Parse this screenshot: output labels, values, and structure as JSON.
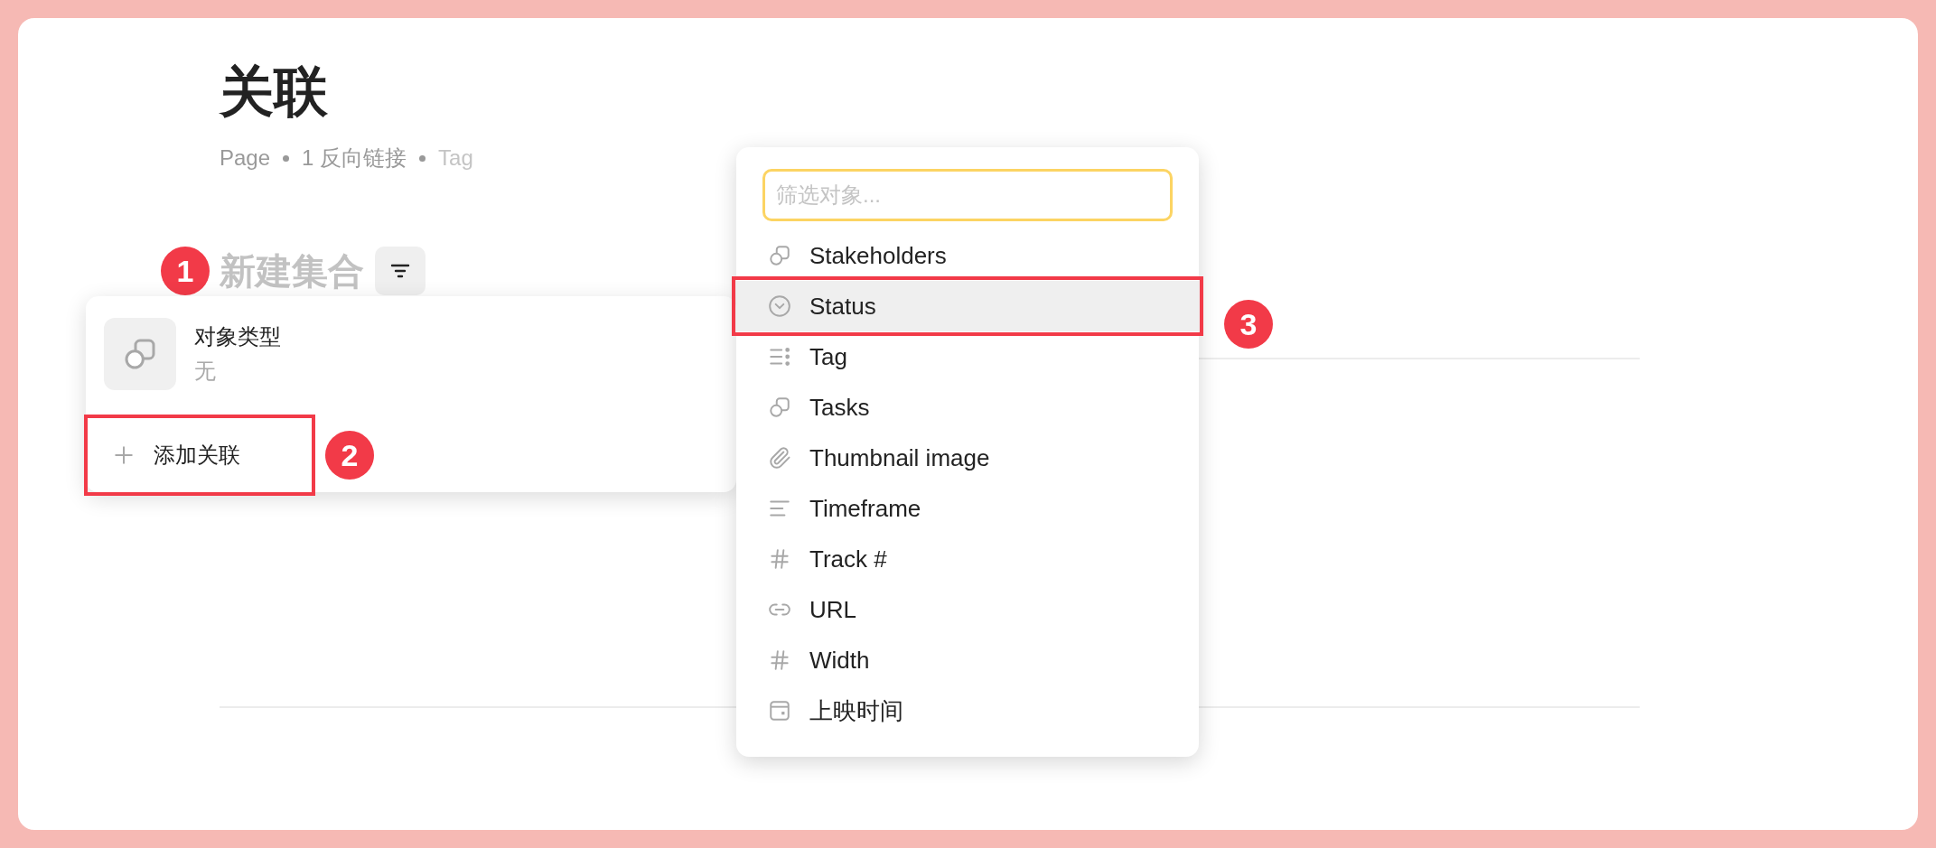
{
  "page": {
    "title": "关联",
    "meta": [
      {
        "text": "Page",
        "muted": false
      },
      {
        "text": "1 反向链接",
        "muted": false
      },
      {
        "text": "Tag",
        "muted": true
      }
    ]
  },
  "collection": {
    "title": "新建集合",
    "badge": "1"
  },
  "relation_popup": {
    "type_label": "对象类型",
    "type_value": "无",
    "add_button": {
      "label": "添加关联",
      "outlined": true
    },
    "badge": "2"
  },
  "object_menu": {
    "search": {
      "placeholder": "筛选对象..."
    },
    "badge": "3",
    "items": [
      {
        "label": "Stakeholders",
        "kind": "relation",
        "selected": false,
        "outlined": false
      },
      {
        "label": "Status",
        "kind": "select",
        "selected": true,
        "outlined": true
      },
      {
        "label": "Tag",
        "kind": "multi_select",
        "selected": false,
        "outlined": false
      },
      {
        "label": "Tasks",
        "kind": "relation",
        "selected": false,
        "outlined": false
      },
      {
        "label": "Thumbnail image",
        "kind": "file",
        "selected": false,
        "outlined": false
      },
      {
        "label": "Timeframe",
        "kind": "text",
        "selected": false,
        "outlined": false
      },
      {
        "label": "Track #",
        "kind": "number",
        "selected": false,
        "outlined": false
      },
      {
        "label": "URL",
        "kind": "url",
        "selected": false,
        "outlined": false
      },
      {
        "label": "Width",
        "kind": "number",
        "selected": false,
        "outlined": false
      },
      {
        "label": "上映时间",
        "kind": "date",
        "selected": false,
        "outlined": false
      }
    ]
  }
}
